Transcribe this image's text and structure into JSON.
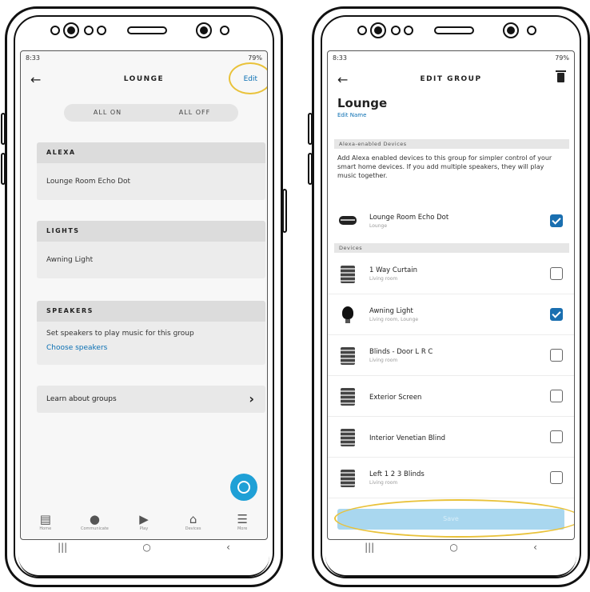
{
  "left_phone": {
    "status": {
      "time": "8:33",
      "right": "79%"
    },
    "title": "LOUNGE",
    "edit_label": "Edit",
    "toggle": {
      "on": "ALL ON",
      "off": "ALL OFF"
    },
    "sections": [
      {
        "header": "ALEXA",
        "items": [
          "Lounge Room Echo Dot"
        ]
      },
      {
        "header": "LIGHTS",
        "items": [
          "Awning Light"
        ]
      },
      {
        "header": "SPEAKERS",
        "text": "Set speakers to play music for this group",
        "link": "Choose speakers"
      }
    ],
    "learn_label": "Learn about groups",
    "nav": [
      {
        "icon": "home-icon",
        "label": "Home"
      },
      {
        "icon": "communicate-icon",
        "label": "Communicate"
      },
      {
        "icon": "play-icon",
        "label": "Play"
      },
      {
        "icon": "devices-icon",
        "label": "Devices"
      },
      {
        "icon": "more-icon",
        "label": "More"
      }
    ]
  },
  "right_phone": {
    "status": {
      "time": "8:33",
      "right": "79%"
    },
    "title": "EDIT GROUP",
    "group_name": "Lounge",
    "edit_name": "Edit Name",
    "alexa_section": "Alexa-enabled Devices",
    "description": "Add Alexa enabled devices to this group for simpler control of your smart home devices. If you add multiple speakers, they will play music together.",
    "echo": {
      "name": "Lounge Room Echo Dot",
      "room": "Lounge",
      "checked": true
    },
    "devices_section": "Devices",
    "devices": [
      {
        "name": "1 Way Curtain",
        "room": "Living room",
        "type": "curtain",
        "checked": false
      },
      {
        "name": "Awning Light",
        "room": "Living room, Lounge",
        "type": "bulb",
        "checked": true
      },
      {
        "name": "Blinds - Door L R C",
        "room": "Living room",
        "type": "curtain",
        "checked": false
      },
      {
        "name": "Exterior Screen",
        "room": "",
        "type": "curtain",
        "checked": false
      },
      {
        "name": "Interior Venetian Blind",
        "room": "",
        "type": "curtain",
        "checked": false
      },
      {
        "name": "Left 1 2 3 Blinds",
        "room": "Living room",
        "type": "curtain",
        "checked": false
      }
    ],
    "save_label": "Save"
  },
  "colors": {
    "accent": "#0a6fb3",
    "highlight": "#e9c23a",
    "fab": "#1fa0d6",
    "save_disabled": "#a9d7ef"
  }
}
